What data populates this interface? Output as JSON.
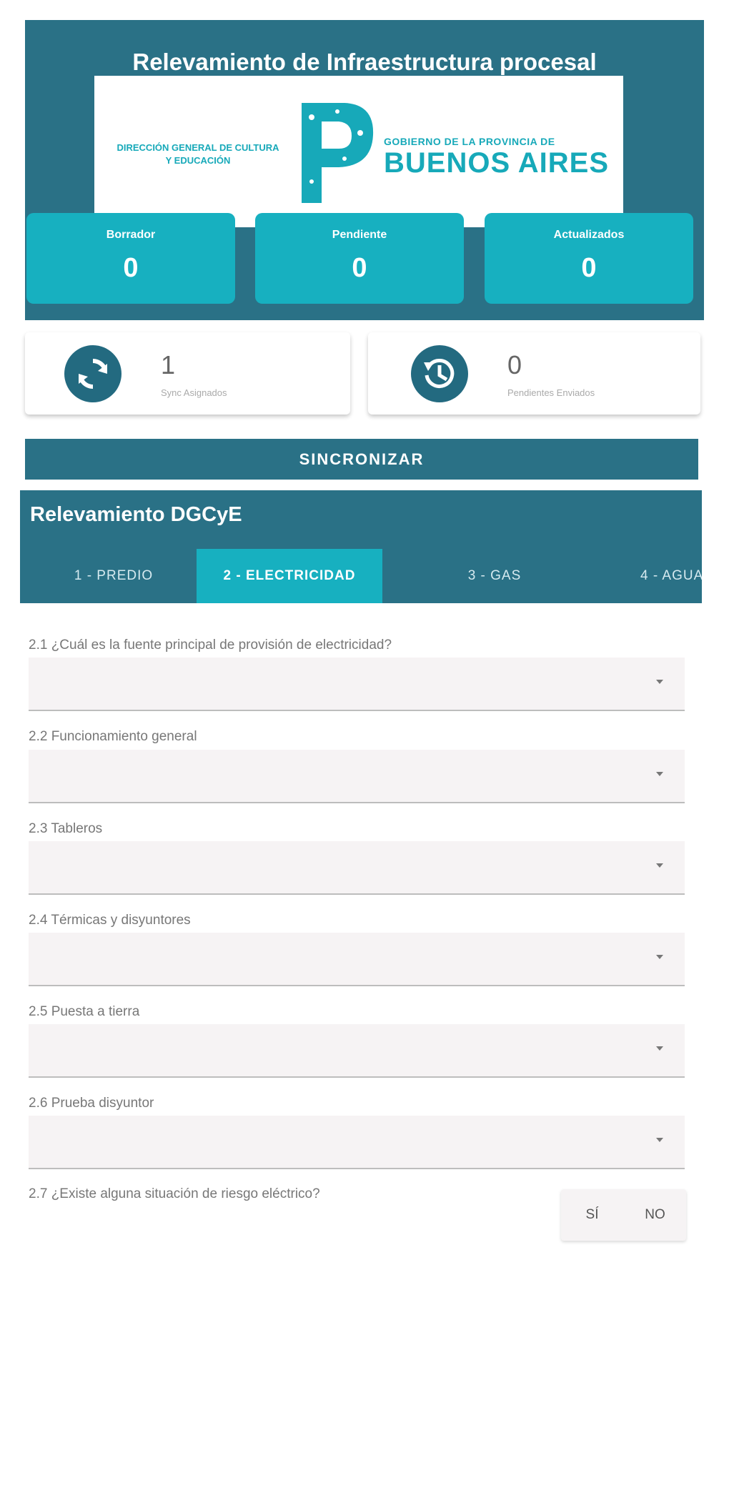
{
  "header": {
    "title": "Relevamiento de Infraestructura procesal",
    "logo": {
      "left_text": "DIRECCIÓN GENERAL DE CULTURA Y EDUCACIÓN",
      "right_top": "GOBIERNO DE LA PROVINCIA DE",
      "right_main": "BUENOS AIRES"
    },
    "stats": [
      {
        "label": "Borrador",
        "value": "0"
      },
      {
        "label": "Pendiente",
        "value": "0"
      },
      {
        "label": "Actualizados",
        "value": "0"
      }
    ]
  },
  "info_cards": [
    {
      "icon": "sync-icon",
      "number": "1",
      "caption": "Sync Asignados"
    },
    {
      "icon": "history-icon",
      "number": "0",
      "caption": "Pendientes Enviados"
    }
  ],
  "sync_button": {
    "label": "SINCRONIZAR"
  },
  "section": {
    "title": "Relevamiento DGCyE",
    "tabs": [
      {
        "label": "1 - PREDIO"
      },
      {
        "label": "2 - ELECTRICIDAD"
      },
      {
        "label": "3 - GAS"
      },
      {
        "label": "4 - AGUA"
      }
    ],
    "active_tab": "2 - ELECTRICIDAD"
  },
  "fields": [
    {
      "label": "2.1 ¿Cuál es la fuente principal de provisión de electricidad?",
      "value": ""
    },
    {
      "label": "2.2 Funcionamiento general",
      "value": ""
    },
    {
      "label": "2.3 Tableros",
      "value": ""
    },
    {
      "label": "2.4 Térmicas y disyuntores",
      "value": ""
    },
    {
      "label": "2.5 Puesta a tierra",
      "value": ""
    },
    {
      "label": "2.6 Prueba disyuntor",
      "value": ""
    }
  ],
  "yes_no_field": {
    "label": "2.7 ¿Existe alguna situación de riesgo eléctrico?",
    "yes": "SÍ",
    "no": "NO"
  },
  "colors": {
    "primary": "#2a7186",
    "accent": "#17b0c0"
  }
}
